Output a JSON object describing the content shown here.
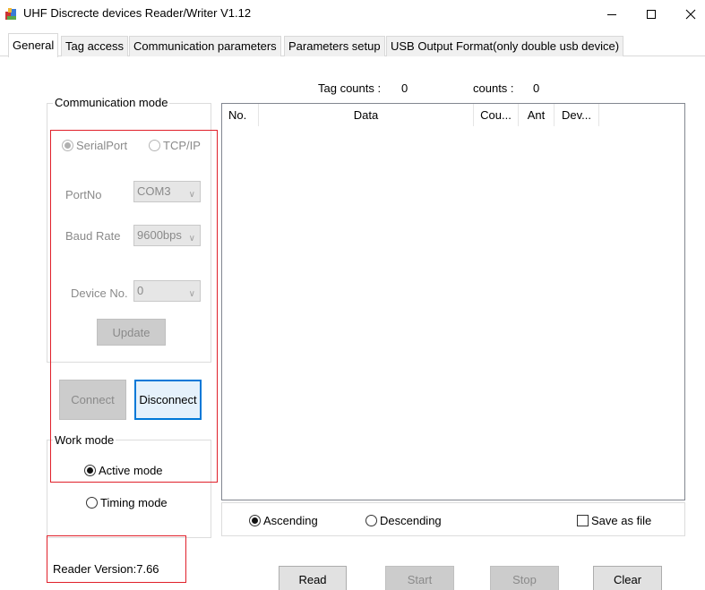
{
  "window": {
    "title": "UHF Discrecte devices Reader/Writer V1.12",
    "minimize_icon": "minimize-icon",
    "maximize_icon": "maximize-icon",
    "close_icon": "close-icon"
  },
  "tabs": [
    {
      "label": "General",
      "active": true
    },
    {
      "label": "Tag access"
    },
    {
      "label": "Communication parameters"
    },
    {
      "label": "Parameters setup"
    },
    {
      "label": "USB Output Format(only double usb device)"
    }
  ],
  "counts": {
    "tag_counts_label": "Tag counts :",
    "tag_counts_value": "0",
    "counts_label": "counts :",
    "counts_value": "0"
  },
  "comm_mode": {
    "title": "Communication mode",
    "serial_label": "SerialPort",
    "tcpip_label": "TCP/IP",
    "selected": "SerialPort",
    "portno_label": "PortNo",
    "portno_value": "COM3",
    "baud_label": "Baud Rate",
    "baud_value": "9600bps",
    "device_label": "Device No.",
    "device_value": "0",
    "update_label": "Update"
  },
  "connection": {
    "connect_label": "Connect",
    "disconnect_label": "Disconnect"
  },
  "work_mode": {
    "title": "Work mode",
    "active_label": "Active mode",
    "timing_label": "Timing mode",
    "selected": "Active mode"
  },
  "reader_version": "Reader Version:7.66",
  "table": {
    "columns": [
      "No.",
      "Data",
      "Cou...",
      "Ant",
      "Dev..."
    ],
    "rows": []
  },
  "sort": {
    "ascending_label": "Ascending",
    "descending_label": "Descending",
    "selected": "Ascending",
    "save_label": "Save as file",
    "save_checked": false
  },
  "actions": {
    "read_label": "Read",
    "start_label": "Start",
    "stop_label": "Stop",
    "clear_label": "Clear"
  },
  "colors": {
    "highlight_red": "#e0202a",
    "focus_blue": "#0078d7"
  }
}
